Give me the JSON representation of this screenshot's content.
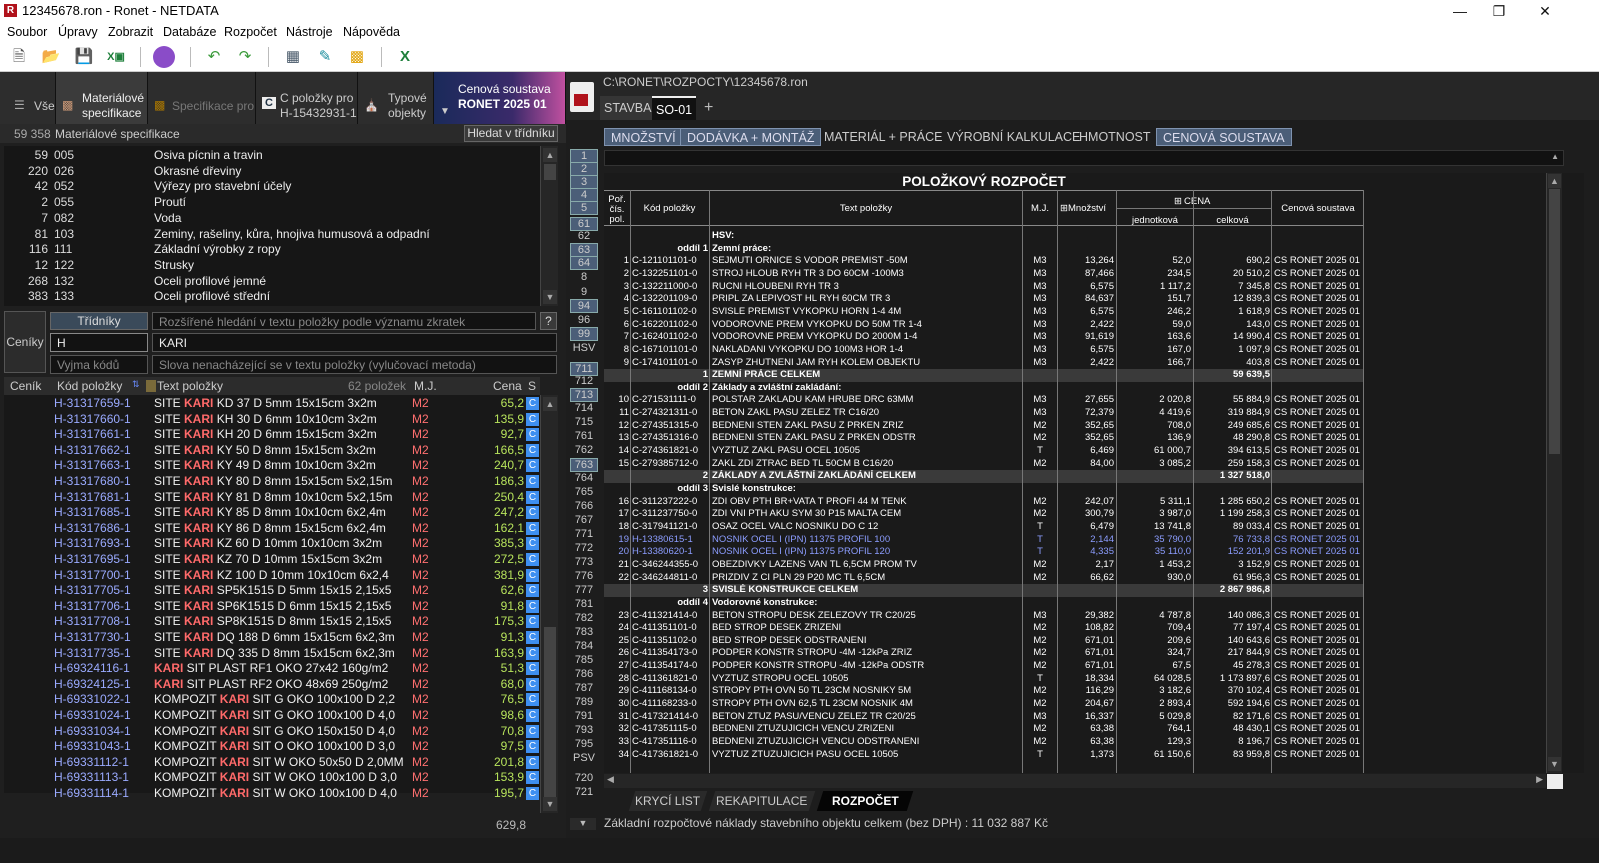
{
  "window": {
    "title": "12345678.ron - Ronet - NETDATA",
    "logo": "R"
  },
  "menu": [
    "Soubor",
    "Úpravy",
    "Zobrazit",
    "Databáze",
    "Rozpočet",
    "Nástroje",
    "Nápověda"
  ],
  "left": {
    "tabs": {
      "all": "Vše",
      "mat1": "Materiálové",
      "mat2": "specifikace",
      "spec": "Specifikace pro",
      "cpol1": "C položky pro",
      "cpol2": "H-15432931-1",
      "typ1": "Typové",
      "typ2": "objekty",
      "price1": "Cenová soustava",
      "price2": "RONET 2025 01"
    },
    "header": {
      "count": "59 358",
      "title": "Materiálové specifikace",
      "search_btn": "Hledat v třídníku"
    },
    "categories": [
      {
        "n": "59",
        "code": "005",
        "name": "Osiva pícnin a travin"
      },
      {
        "n": "220",
        "code": "026",
        "name": "Okrasné dřeviny"
      },
      {
        "n": "42",
        "code": "052",
        "name": "Výřezy pro stavební účely"
      },
      {
        "n": "2",
        "code": "055",
        "name": "Proutí"
      },
      {
        "n": "7",
        "code": "082",
        "name": "Voda"
      },
      {
        "n": "81",
        "code": "103",
        "name": "Zeminy, rašeliny, kůra, hnojiva humusová a odpadní"
      },
      {
        "n": "116",
        "code": "111",
        "name": "Základní výrobky z ropy"
      },
      {
        "n": "12",
        "code": "122",
        "name": "Strusky"
      },
      {
        "n": "268",
        "code": "132",
        "name": "Oceli profilové jemné"
      },
      {
        "n": "383",
        "code": "133",
        "name": "Oceli profilové střední"
      }
    ],
    "filters": {
      "ceniky": "Ceníky",
      "tridniky": "Třídníky",
      "ext_placeholder": "Rozšířené hledání v textu položky podle významu zkratek",
      "help": "?",
      "code_value": "H",
      "text_value": "KARI",
      "excl_code": "Vyjma kódů",
      "excl_text": "Slova nenacházející se v textu položky (vylučovací metoda)"
    },
    "columns": {
      "cenik": "Ceník",
      "kod": "Kód položky",
      "text": "Text položky",
      "count": "62 položek",
      "mj": "M.J.",
      "cena": "Cena",
      "s": "S"
    },
    "items": [
      {
        "k": "H-31317659-1",
        "a": "SITE ",
        "b": "KARI",
        "c": " KD 37 D 5mm 15x15cm 3x2m",
        "u": "M2",
        "p": "65,2"
      },
      {
        "k": "H-31317660-1",
        "a": "SITE ",
        "b": "KARI",
        "c": " KH 30 D 6mm 10x10cm 3x2m",
        "u": "M2",
        "p": "135,9"
      },
      {
        "k": "H-31317661-1",
        "a": "SITE ",
        "b": "KARI",
        "c": " KH 20 D 6mm 15x15cm 3x2m",
        "u": "M2",
        "p": "92,7"
      },
      {
        "k": "H-31317662-1",
        "a": "SITE ",
        "b": "KARI",
        "c": " KY 50 D 8mm 15x15cm 3x2m",
        "u": "M2",
        "p": "166,5"
      },
      {
        "k": "H-31317663-1",
        "a": "SITE ",
        "b": "KARI",
        "c": " KY 49 D 8mm 10x10cm 3x2m",
        "u": "M2",
        "p": "240,7"
      },
      {
        "k": "H-31317680-1",
        "a": "SITE ",
        "b": "KARI",
        "c": " KY 80 D 8mm 15x15cm 5x2,15m",
        "u": "M2",
        "p": "186,3"
      },
      {
        "k": "H-31317681-1",
        "a": "SITE ",
        "b": "KARI",
        "c": " KY 81 D 8mm 10x10cm 5x2,15m",
        "u": "M2",
        "p": "250,4"
      },
      {
        "k": "H-31317685-1",
        "a": "SITE ",
        "b": "KARI",
        "c": " KY 85 D 8mm 10x10cm 6x2,4m",
        "u": "M2",
        "p": "247,2"
      },
      {
        "k": "H-31317686-1",
        "a": "SITE ",
        "b": "KARI",
        "c": " KY 86 D 8mm 15x15cm 6x2,4m",
        "u": "M2",
        "p": "162,1"
      },
      {
        "k": "H-31317693-1",
        "a": "SITE ",
        "b": "KARI",
        "c": " KZ 60 D 10mm 10x10cm 3x2m",
        "u": "M2",
        "p": "385,3"
      },
      {
        "k": "H-31317695-1",
        "a": "SITE ",
        "b": "KARI",
        "c": " KZ 70 D 10mm 15x15cm 3x2m",
        "u": "M2",
        "p": "272,5"
      },
      {
        "k": "H-31317700-1",
        "a": "SITE ",
        "b": "KARI",
        "c": " KZ 100 D 10mm 10x10cm 6x2,4",
        "u": "M2",
        "p": "381,9"
      },
      {
        "k": "H-31317705-1",
        "a": "SITE ",
        "b": "KARI",
        "c": " SP5K1515 D 5mm 15x15 2,15x5",
        "u": "M2",
        "p": "62,6"
      },
      {
        "k": "H-31317706-1",
        "a": "SITE ",
        "b": "KARI",
        "c": " SP6K1515 D 6mm 15x15 2,15x5",
        "u": "M2",
        "p": "91,8"
      },
      {
        "k": "H-31317708-1",
        "a": "SITE ",
        "b": "KARI",
        "c": " SP8K1515 D 8mm 15x15 2,15x5",
        "u": "M2",
        "p": "175,3"
      },
      {
        "k": "H-31317730-1",
        "a": "SITE ",
        "b": "KARI",
        "c": " DQ 188 D 6mm 15x15cm 6x2,3m",
        "u": "M2",
        "p": "91,3"
      },
      {
        "k": "H-31317735-1",
        "a": "SITE ",
        "b": "KARI",
        "c": " DQ 335 D 8mm 15x15cm 6x2,3m",
        "u": "M2",
        "p": "163,9"
      },
      {
        "k": "H-69324116-1",
        "a": "",
        "b": "KARI",
        "c": " SIT PLAST RF1 OKO 27x42 160g/m2",
        "u": "M2",
        "p": "51,3"
      },
      {
        "k": "H-69324125-1",
        "a": "",
        "b": "KARI",
        "c": " SIT PLAST RF2 OKO 48x69 250g/m2",
        "u": "M2",
        "p": "68,0"
      },
      {
        "k": "H-69331022-1",
        "a": "KOMPOZIT ",
        "b": "KARI",
        "c": " SIT G OKO 100x100 D 2,2",
        "u": "M2",
        "p": "76,5"
      },
      {
        "k": "H-69331024-1",
        "a": "KOMPOZIT ",
        "b": "KARI",
        "c": " SIT G OKO 100x100 D 4,0",
        "u": "M2",
        "p": "98,6"
      },
      {
        "k": "H-69331034-1",
        "a": "KOMPOZIT ",
        "b": "KARI",
        "c": " SIT G OKO 150x150 D 4,0",
        "u": "M2",
        "p": "70,8"
      },
      {
        "k": "H-69331043-1",
        "a": "KOMPOZIT ",
        "b": "KARI",
        "c": " SIT O OKO 100x100 D 3,0",
        "u": "M2",
        "p": "97,5"
      },
      {
        "k": "H-69331112-1",
        "a": "KOMPOZIT ",
        "b": "KARI",
        "c": " SIT W OKO 50x50 D 2,0MM",
        "u": "M2",
        "p": "201,8"
      },
      {
        "k": "H-69331113-1",
        "a": "KOMPOZIT ",
        "b": "KARI",
        "c": " SIT W OKO 100x100 D 3,0",
        "u": "M2",
        "p": "153,9"
      },
      {
        "k": "H-69331114-1",
        "a": "KOMPOZIT ",
        "b": "KARI",
        "c": " SIT W OKO 100x100 D 4,0",
        "u": "M2",
        "p": "195,7"
      }
    ],
    "item_s": "C",
    "footer_value": "629,8"
  },
  "right": {
    "path": "C:\\RONET\\ROZPOCTY\\12345678.ron",
    "tabs": {
      "stavba": "STAVBA",
      "so": "SO-01",
      "add": "+"
    },
    "views": [
      "MNOŽSTVÍ",
      "DODÁVKA + MONTÁŽ",
      "MATERIÁL + PRÁCE",
      "VÝROBNÍ KALKULACE",
      "HMOTNOST",
      "CENOVÁ SOUSTAVA"
    ],
    "line_numbers": [
      "1",
      "2",
      "3",
      "4",
      "5",
      "61",
      "62",
      "63",
      "64",
      "8",
      "9",
      "94",
      "96",
      "99",
      "HSV",
      "711",
      "712",
      "713",
      "714",
      "715",
      "761",
      "762",
      "763",
      "764",
      "765",
      "766",
      "767",
      "771",
      "772",
      "773",
      "776",
      "777",
      "781",
      "782",
      "783",
      "784",
      "785",
      "786",
      "787",
      "789",
      "791",
      "793",
      "795",
      "PSV",
      "720",
      "721"
    ],
    "sheet_title": "POLOŽKOVÝ ROZPOČET",
    "head": {
      "por1": "Poř.",
      "por2": "čís.",
      "por3": "pol.",
      "kod": "Kód položky",
      "text": "Text položky",
      "mj": "M.J.",
      "mnoz": "Množství",
      "cena": "CENA",
      "jedn": "jednotková",
      "celk": "celková",
      "sous": "Cenová soustava",
      "expand": "⊞"
    },
    "rows": [
      {
        "t": "sec",
        "text": "HSV:"
      },
      {
        "t": "sec",
        "odd": "oddíl 1",
        "text": "Zemní práce:"
      },
      {
        "n": "1",
        "k": "C-121101101-0",
        "x": "SEJMUTI ORNICE S VODOR PREMIST -50M",
        "u": "M3",
        "q": "13,264",
        "j": "52,0",
        "c": "690,2",
        "s": "CS RONET 2025 01"
      },
      {
        "n": "2",
        "k": "C-132251101-0",
        "x": "STROJ HLOUB RYH TR 3 DO 60CM -100M3",
        "u": "M3",
        "q": "87,466",
        "j": "234,5",
        "c": "20 510,2",
        "s": "CS RONET 2025 01"
      },
      {
        "n": "3",
        "k": "C-132211000-0",
        "x": "RUCNI HLOUBENI RYH TR 3",
        "u": "M3",
        "q": "6,575",
        "j": "1 117,2",
        "c": "7 345,8",
        "s": "CS RONET 2025 01"
      },
      {
        "n": "4",
        "k": "C-132201109-0",
        "x": "PRIPL ZA LEPIVOST HL RYH 60CM TR 3",
        "u": "M3",
        "q": "84,637",
        "j": "151,7",
        "c": "12 839,3",
        "s": "CS RONET 2025 01"
      },
      {
        "n": "5",
        "k": "C-161101102-0",
        "x": "SVISLE PREMIST VYKOPKU HORN 1-4 4M",
        "u": "M3",
        "q": "6,575",
        "j": "246,2",
        "c": "1 618,9",
        "s": "CS RONET 2025 01"
      },
      {
        "n": "6",
        "k": "C-162201102-0",
        "x": "VODOROVNE PREM VYKOPKU DO 50M TR 1-4",
        "u": "M3",
        "q": "2,422",
        "j": "59,0",
        "c": "143,0",
        "s": "CS RONET 2025 01"
      },
      {
        "n": "7",
        "k": "C-162401102-0",
        "x": "VODOROVNE PREM VYKOPKU DO 2000M 1-4",
        "u": "M3",
        "q": "91,619",
        "j": "163,6",
        "c": "14 990,4",
        "s": "CS RONET 2025 01"
      },
      {
        "n": "8",
        "k": "C-167101101-0",
        "x": "NAKLADANI VYKOPKU DO 100M3 HOR 1-4",
        "u": "M3",
        "q": "6,575",
        "j": "167,0",
        "c": "1 097,9",
        "s": "CS RONET 2025 01"
      },
      {
        "n": "9",
        "k": "C-174101101-0",
        "x": "ZASYP ZHUTNENI JAM RYH KOLEM OBJEKTU",
        "u": "M3",
        "q": "2,422",
        "j": "166,7",
        "c": "403,8",
        "s": "CS RONET 2025 01"
      },
      {
        "t": "tot",
        "n": "1",
        "text": "ZEMNÍ PRÁCE CELKEM",
        "c": "59 639,5"
      },
      {
        "t": "sec",
        "odd": "oddíl 2",
        "text": "Základy a zvláštní zakládání:"
      },
      {
        "n": "10",
        "k": "C-271531111-0",
        "x": "POLSTAR ZAKLADU KAM HRUBE DRC 63MM",
        "u": "M3",
        "q": "27,655",
        "j": "2 020,8",
        "c": "55 884,9",
        "s": "CS RONET 2025 01"
      },
      {
        "n": "11",
        "k": "C-274321311-0",
        "x": "BETON ZAKL PASU ZELEZ TR C16/20",
        "u": "M3",
        "q": "72,379",
        "j": "4 419,6",
        "c": "319 884,9",
        "s": "CS RONET 2025 01"
      },
      {
        "n": "12",
        "k": "C-274351315-0",
        "x": "BEDNENI STEN ZAKL PASU Z PRKEN ZRIZ",
        "u": "M2",
        "q": "352,65",
        "j": "708,0",
        "c": "249 685,6",
        "s": "CS RONET 2025 01"
      },
      {
        "n": "13",
        "k": "C-274351316-0",
        "x": "BEDNENI STEN ZAKL PASU Z PRKEN ODSTR",
        "u": "M2",
        "q": "352,65",
        "j": "136,9",
        "c": "48 290,8",
        "s": "CS RONET 2025 01"
      },
      {
        "n": "14",
        "k": "C-274361821-0",
        "x": "VYZTUZ ZAKL PASU OCEL 10505",
        "u": "T",
        "q": "6,469",
        "j": "61 000,7",
        "c": "394 613,5",
        "s": "CS RONET 2025 01"
      },
      {
        "n": "15",
        "k": "C-279385712-0",
        "x": "ZAKL ZDI ZTRAC BED TL 50CM B C16/20",
        "u": "M2",
        "q": "84,00",
        "j": "3 085,2",
        "c": "259 158,3",
        "s": "CS RONET 2025 01"
      },
      {
        "t": "tot",
        "n": "2",
        "text": "ZÁKLADY A ZVLÁŠTNÍ ZAKLÁDÁNÍ CELKEM",
        "c": "1 327 518,0"
      },
      {
        "t": "sec",
        "odd": "oddíl 3",
        "text": "Svislé konstrukce:"
      },
      {
        "n": "16",
        "k": "C-311237222-0",
        "x": "ZDI OBV PTH BR+VATA T PROFI 44 M TENK",
        "u": "M2",
        "q": "242,07",
        "j": "5 311,1",
        "c": "1 285 650,2",
        "s": "CS RONET 2025 01"
      },
      {
        "n": "17",
        "k": "C-311237750-0",
        "x": "ZDI VNI PTH AKU SYM 30 P15 MALTA CEM",
        "u": "M2",
        "q": "300,79",
        "j": "3 987,0",
        "c": "1 199 258,3",
        "s": "CS RONET 2025 01"
      },
      {
        "n": "18",
        "k": "C-317941121-0",
        "x": "OSAZ OCEL VALC NOSNIKU DO C 12",
        "u": "T",
        "q": "6,479",
        "j": "13 741,8",
        "c": "89 033,4",
        "s": "CS RONET 2025 01"
      },
      {
        "b": 1,
        "n": "19",
        "k": "H-13380615-1",
        "x": "NOSNIK OCEL I (IPN) 11375 PROFIL 100",
        "u": "T",
        "q": "2,144",
        "j": "35 790,0",
        "c": "76 733,8",
        "s": "CS RONET 2025 01"
      },
      {
        "b": 1,
        "n": "20",
        "k": "H-13380620-1",
        "x": "NOSNIK OCEL I (IPN) 11375 PROFIL 120",
        "u": "T",
        "q": "4,335",
        "j": "35 110,0",
        "c": "152 201,9",
        "s": "CS RONET 2025 01"
      },
      {
        "n": "21",
        "k": "C-346244355-0",
        "x": "OBEZDIVKY LAZENS VAN TL 6,5CM PROM TV",
        "u": "M2",
        "q": "2,17",
        "j": "1 453,2",
        "c": "3 152,9",
        "s": "CS RONET 2025 01"
      },
      {
        "n": "22",
        "k": "C-346244811-0",
        "x": "PRIZDIV Z CI PLN 29 P20 MC TL 6,5CM",
        "u": "M2",
        "q": "66,62",
        "j": "930,0",
        "c": "61 956,3",
        "s": "CS RONET 2025 01"
      },
      {
        "t": "tot",
        "n": "3",
        "text": "SVISLÉ KONSTRUKCE CELKEM",
        "c": "2 867 986,8"
      },
      {
        "t": "sec",
        "odd": "oddíl 4",
        "text": "Vodorovné konstrukce:"
      },
      {
        "n": "23",
        "k": "C-411321414-0",
        "x": "BETON STROPU DESK ZELEZOVY TR C20/25",
        "u": "M3",
        "q": "29,382",
        "j": "4 787,8",
        "c": "140 086,3",
        "s": "CS RONET 2025 01"
      },
      {
        "n": "24",
        "k": "C-411351101-0",
        "x": "BED STROP DESEK ZRIZENI",
        "u": "M2",
        "q": "108,82",
        "j": "709,4",
        "c": "77 197,4",
        "s": "CS RONET 2025 01"
      },
      {
        "n": "25",
        "k": "C-411351102-0",
        "x": "BED STROP DESEK ODSTRANENI",
        "u": "M2",
        "q": "671,01",
        "j": "209,6",
        "c": "140 643,6",
        "s": "CS RONET 2025 01"
      },
      {
        "n": "26",
        "k": "C-411354173-0",
        "x": "PODPER KONSTR STROPU -4M -12kPa ZRIZ",
        "u": "M2",
        "q": "671,01",
        "j": "324,7",
        "c": "217 844,9",
        "s": "CS RONET 2025 01"
      },
      {
        "n": "27",
        "k": "C-411354174-0",
        "x": "PODPER KONSTR STROPU -4M -12kPa ODSTR",
        "u": "M2",
        "q": "671,01",
        "j": "67,5",
        "c": "45 278,3",
        "s": "CS RONET 2025 01"
      },
      {
        "n": "28",
        "k": "C-411361821-0",
        "x": "VYZTUZ STROPU OCEL 10505",
        "u": "T",
        "q": "18,334",
        "j": "64 028,5",
        "c": "1 173 897,6",
        "s": "CS RONET 2025 01"
      },
      {
        "n": "29",
        "k": "C-411168134-0",
        "x": "STROPY PTH OVN 50 TL 23CM NOSNIKY 5M",
        "u": "M2",
        "q": "116,29",
        "j": "3 182,6",
        "c": "370 102,4",
        "s": "CS RONET 2025 01"
      },
      {
        "n": "30",
        "k": "C-411168233-0",
        "x": "STROPY PTH OVN 62,5 TL 23CM NOSNIK 4M",
        "u": "M2",
        "q": "204,67",
        "j": "2 893,4",
        "c": "592 194,6",
        "s": "CS RONET 2025 01"
      },
      {
        "n": "31",
        "k": "C-417321414-0",
        "x": "BETON ZTUZ PASU/VENCU ZELEZ TR C20/25",
        "u": "M3",
        "q": "16,337",
        "j": "5 029,8",
        "c": "82 171,6",
        "s": "CS RONET 2025 01"
      },
      {
        "n": "32",
        "k": "C-417351115-0",
        "x": "BEDNENI ZTUZUJICICH VENCU ZRIZENI",
        "u": "M2",
        "q": "63,38",
        "j": "764,1",
        "c": "48 430,1",
        "s": "CS RONET 2025 01"
      },
      {
        "n": "33",
        "k": "C-417351116-0",
        "x": "BEDNENI ZTUZUJICICH VENCU ODSTRANENI",
        "u": "M2",
        "q": "63,38",
        "j": "129,3",
        "c": "8 196,7",
        "s": "CS RONET 2025 01"
      },
      {
        "n": "34",
        "k": "C-417361821-0",
        "x": "VYZTUZ ZTUZUJICICH PASU OCEL 10505",
        "u": "T",
        "q": "1,373",
        "j": "61 150,6",
        "c": "83 959,8",
        "s": "CS RONET 2025 01"
      }
    ],
    "bottom_tabs": [
      "KRYCÍ LIST",
      "REKAPITULACE",
      "ROZPOČET"
    ],
    "status": "Základní rozpočtové náklady stavebního objektu celkem (bez DPH) : 11 032 887 Kč"
  }
}
